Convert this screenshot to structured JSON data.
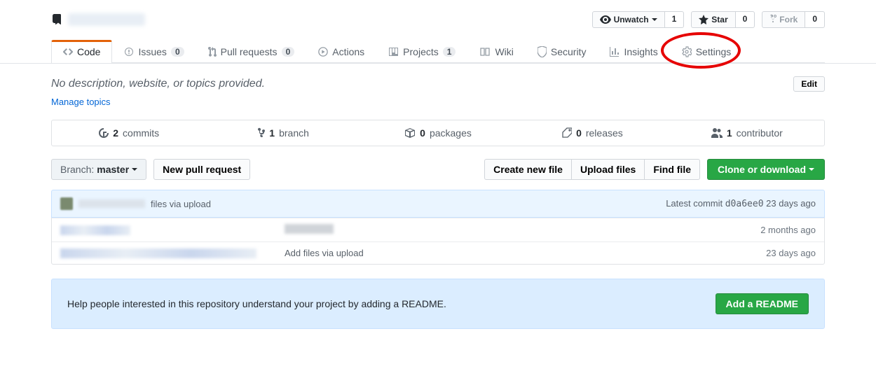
{
  "header": {
    "unwatch": "Unwatch",
    "unwatch_count": "1",
    "star": "Star",
    "star_count": "0",
    "fork": "Fork",
    "fork_count": "0"
  },
  "tabs": {
    "code": "Code",
    "issues": "Issues",
    "issues_count": "0",
    "pulls": "Pull requests",
    "pulls_count": "0",
    "actions": "Actions",
    "projects": "Projects",
    "projects_count": "1",
    "wiki": "Wiki",
    "security": "Security",
    "insights": "Insights",
    "settings": "Settings"
  },
  "desc": {
    "text": "No description, website, or topics provided.",
    "edit": "Edit",
    "manage": "Manage topics"
  },
  "numbers": {
    "commits_n": "2",
    "commits": "commits",
    "branch_n": "1",
    "branch": "branch",
    "packages_n": "0",
    "packages": "packages",
    "releases_n": "0",
    "releases": "releases",
    "contrib_n": "1",
    "contrib": "contributor"
  },
  "toolbar": {
    "branch_label": "Branch:",
    "branch_value": "master",
    "new_pr": "New pull request",
    "create_file": "Create new file",
    "upload_files": "Upload files",
    "find_file": "Find file",
    "clone": "Clone or download"
  },
  "commit": {
    "suffix": "files via upload",
    "latest": "Latest commit",
    "sha": "d0a6ee0",
    "when": "23 days ago"
  },
  "files": {
    "row1_time": "2 months ago",
    "row2_msg": "Add files via upload",
    "row2_time": "23 days ago"
  },
  "readme": {
    "text": "Help people interested in this repository understand your project by adding a README.",
    "button": "Add a README"
  }
}
